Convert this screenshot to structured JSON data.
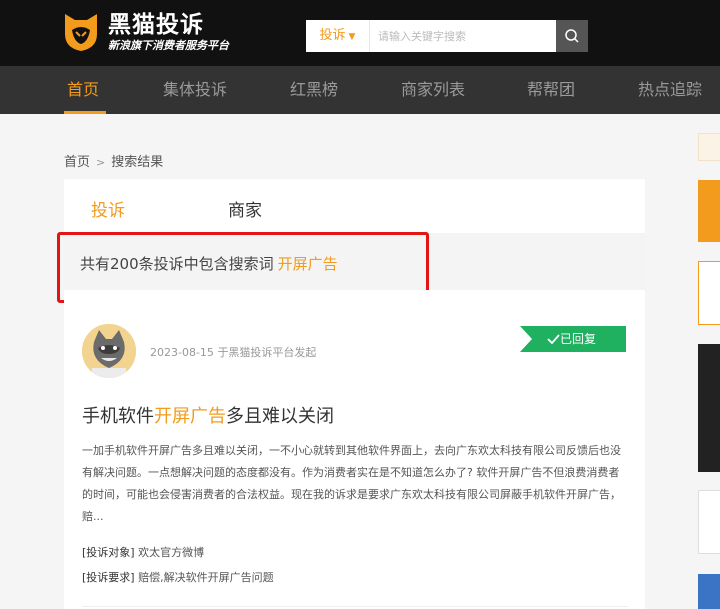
{
  "header": {
    "logo_title": "黑猫投诉",
    "logo_subtitle": "新浪旗下消费者服务平台",
    "search": {
      "type_label": "投诉",
      "placeholder": "请输入关键字搜索"
    }
  },
  "nav": {
    "items": [
      {
        "label": "首页",
        "active": true
      },
      {
        "label": "集体投诉"
      },
      {
        "label": "红黑榜"
      },
      {
        "label": "商家列表"
      },
      {
        "label": "帮帮团"
      },
      {
        "label": "热点追踪"
      }
    ]
  },
  "breadcrumb": {
    "home": "首页",
    "separator": ">",
    "current": "搜索结果"
  },
  "tabs": [
    "投诉",
    "商家"
  ],
  "result_summary": {
    "text": "共有200条投诉中包含搜索词",
    "keyword": "开屏广告"
  },
  "complaint": {
    "date": "2023-08-15",
    "source": "于黑猫投诉平台发起",
    "status": "已回复",
    "title_prefix": "手机软件",
    "title_keyword": "开屏广告",
    "title_suffix": "多且难以关闭",
    "body": "一加手机软件开屏广告多且难以关闭，一不小心就转到其他软件界面上，去向广东欢太科技有限公司反馈后也没有解决问题。一点想解决问题的态度都没有。作为消费者实在是不知道怎么办了? 软件开屏广告不但浪费消费者的时间，可能也会侵害消费者的合法权益。现在我的诉求是要求广东欢太科技有限公司屏蔽手机软件开屏广告，赔...",
    "target_label": "[投诉对象]",
    "target_value": "欢太官方微博",
    "demand_label": "[投诉要求]",
    "demand_value": "赔偿,解决软件开屏广告问题"
  },
  "colors": {
    "accent": "#f29b1d",
    "status_green": "#1fb160",
    "highlight_box": "#e21414"
  }
}
